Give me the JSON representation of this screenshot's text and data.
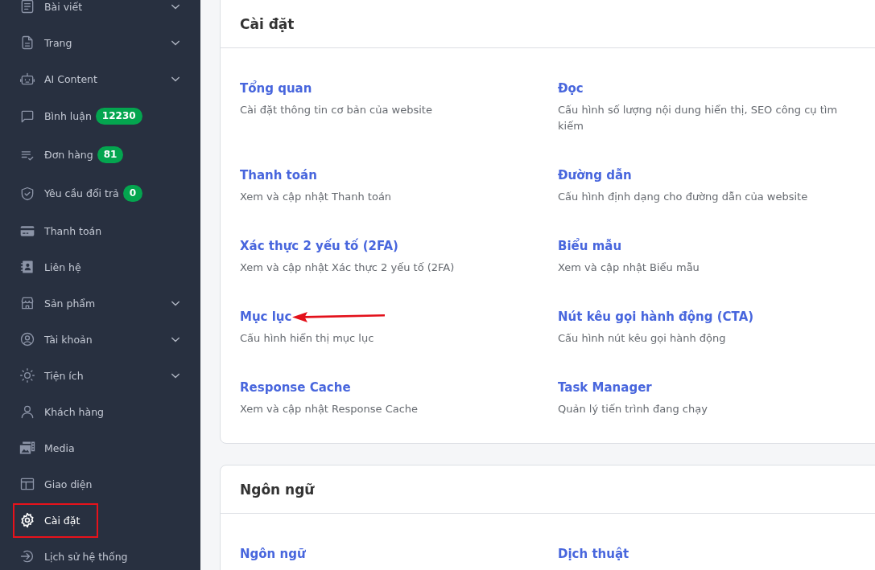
{
  "sidebar": {
    "items": [
      {
        "label": "Bài viết",
        "expandable": true,
        "selected": false,
        "outlined": false
      },
      {
        "label": "Trang",
        "expandable": true,
        "selected": false,
        "outlined": false
      },
      {
        "label": "AI Content",
        "expandable": true,
        "selected": false,
        "outlined": false
      },
      {
        "label": "Bình luận",
        "badge": "12230",
        "expandable": false,
        "selected": false,
        "outlined": false
      },
      {
        "label": "Đơn hàng",
        "badge": "81",
        "expandable": false,
        "selected": false,
        "outlined": false
      },
      {
        "label": "Yêu cầu đổi trả",
        "badge": "0",
        "expandable": false,
        "selected": false,
        "outlined": false
      },
      {
        "label": "Thanh toán",
        "expandable": false,
        "selected": false,
        "outlined": false
      },
      {
        "label": "Liên hệ",
        "expandable": false,
        "selected": false,
        "outlined": false
      },
      {
        "label": "Sản phẩm",
        "expandable": true,
        "selected": false,
        "outlined": false
      },
      {
        "label": "Tài khoản",
        "expandable": true,
        "selected": false,
        "outlined": false
      },
      {
        "label": "Tiện ích",
        "expandable": true,
        "selected": false,
        "outlined": false
      },
      {
        "label": "Khách hàng",
        "expandable": false,
        "selected": false,
        "outlined": false
      },
      {
        "label": "Media",
        "expandable": false,
        "selected": false,
        "outlined": false
      },
      {
        "label": "Giao diện",
        "expandable": false,
        "selected": false,
        "outlined": false
      },
      {
        "label": "Cài đặt",
        "expandable": false,
        "selected": true,
        "outlined": true
      },
      {
        "label": "Lịch sử hệ thống",
        "expandable": false,
        "selected": false,
        "outlined": false
      }
    ]
  },
  "sections": [
    {
      "title": "Cài đặt",
      "items": [
        {
          "title": "Tổng quan",
          "description": "Cài đặt thông tin cơ bản của website",
          "pointed_at": false
        },
        {
          "title": "Đọc",
          "description": "Cấu hình số lượng nội dung hiển thị, SEO công cụ tìm kiếm",
          "pointed_at": false
        },
        {
          "title": "Thanh toán",
          "description": "Xem và cập nhật Thanh toán",
          "pointed_at": false
        },
        {
          "title": "Đường dẫn",
          "description": "Cấu hình định dạng cho đường dẫn của website",
          "pointed_at": false
        },
        {
          "title": "Xác thực 2 yếu tố (2FA)",
          "description": "Xem và cập nhật Xác thực 2 yếu tố (2FA)",
          "pointed_at": false
        },
        {
          "title": "Biểu mẫu",
          "description": "Xem và cập nhật Biểu mẫu",
          "pointed_at": false
        },
        {
          "title": "Mục lục",
          "description": "Cấu hình hiển thị mục lục",
          "pointed_at": true
        },
        {
          "title": "Nút kêu gọi hành động (CTA)",
          "description": "Cấu hình nút kêu gọi hành động",
          "pointed_at": false
        },
        {
          "title": "Response Cache",
          "description": "Xem và cập nhật Response Cache",
          "pointed_at": false
        },
        {
          "title": "Task Manager",
          "description": "Quản lý tiến trình đang chạy",
          "pointed_at": false
        }
      ]
    },
    {
      "title": "Ngôn ngữ",
      "items": [
        {
          "title": "Ngôn ngữ",
          "pointed_at": false
        },
        {
          "title": "Dịch thuật",
          "pointed_at": false
        }
      ]
    }
  ]
}
